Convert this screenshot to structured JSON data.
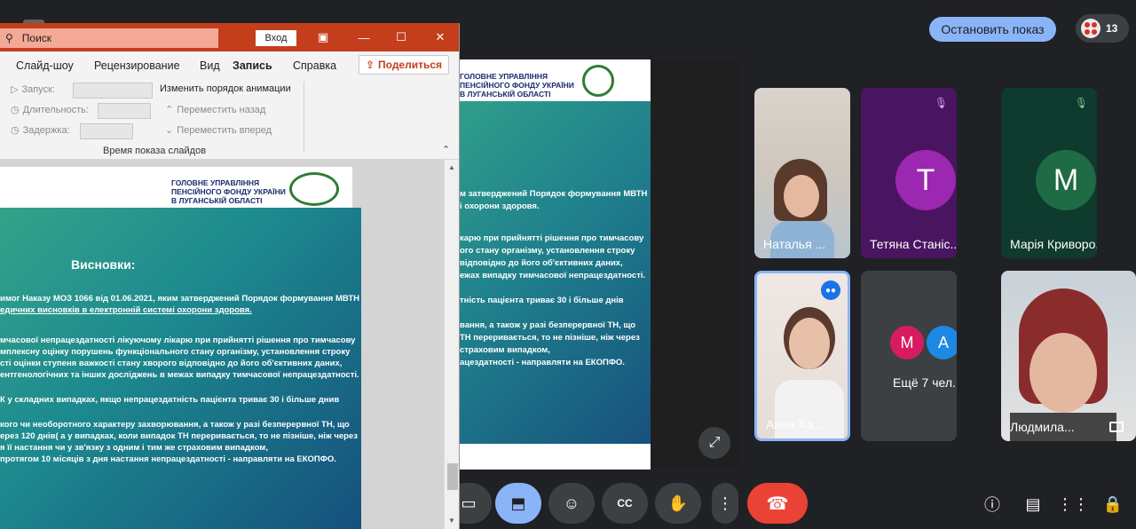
{
  "meet": {
    "stop_presenting": "Остановить показ",
    "participants_count": "13",
    "more_people": "Ещё 7 чел."
  },
  "ppt": {
    "search_placeholder": "Поиск",
    "login": "Вход",
    "tabs": [
      "Слайд-шоу",
      "Рецензирование",
      "Вид",
      "Запись",
      "Справка"
    ],
    "share": "Поделиться",
    "ribbon": {
      "start": "Запуск:",
      "duration": "Длительность:",
      "delay": "Задержка:",
      "reorder": "Изменить порядок анимации",
      "move_back": "Переместить назад",
      "move_forward": "Переместить вперед",
      "group_label": "Время показа слайдов"
    }
  },
  "slide": {
    "org_line1": "ГОЛОВНЕ УПРАВЛІННЯ",
    "org_line2": "ПЕНСІЙНОГО ФОНДУ УКРАЇНИ",
    "org_line3": "В ЛУГАНСЬКІЙ ОБЛАСТІ",
    "title": "Висновки:",
    "lines": [
      "имог Наказу МОЗ 1066 від 01.06.2021, яким затверджений Порядок формування МВТН",
      "едичних висновків в  електронній системі охорони здоровя.",
      "мчасової непрацездатності лікуючому лікарю при прийнятті рішення про тимчасову",
      "мплексну оцінку порушень функціонального стану організму, установлення строку",
      "сті оцінки ступеня важкості стану хворого відповідно до його об'єктивних даних,",
      "ентгенологічних та інших досліджень в межах випадку тимчасової непрацездатності.",
      "К у складних випадках, якщо непрацездатність пацієнта триває 30 і більше днив",
      "кого чи необоротного характеру захворювання, а також у разі безперервної ТН, що",
      "ерез 120 днів( а у випадках, коли випадок ТН переривається, то не пізніше, ніж через",
      "я її настання чи у зв'язку з одним і тим же страховим випадком,",
      "протягом 10 місяців з дня настання непрацездатності - направляти на ЕКОПФО."
    ],
    "present_lines": [
      "м затверджений Порядок формування МВТН",
      "і охорони здоровя.",
      "карю при прийнятті рішення про тимчасову",
      "ого стану організму, установлення строку",
      "відповідно до його об'єктивних даних,",
      "ежах випадку тимчасової непрацездатності.",
      "тність пацієнта триває 30 і більше днів",
      "вання, а також у разі безперервної ТН, що",
      " ТН переривається, то не пізніше, ніж через",
      " страховим випадком,",
      "ацездатності - направляти на ЕКОПФО."
    ]
  },
  "tiles": [
    {
      "name": "Наталья ...",
      "initial": ""
    },
    {
      "name": "Тетяна Станіс...",
      "initial": "Т",
      "color": "#9c27b0"
    },
    {
      "name": "Марія Криворо...",
      "initial": "М",
      "color": "#1e8e3e"
    },
    {
      "name": "Анна Ха...",
      "initial": ""
    },
    {
      "name": "Людмила...",
      "initial": ""
    }
  ],
  "more_avatars": [
    {
      "initial": "М",
      "color": "#d81b60"
    },
    {
      "initial": "А",
      "color": "#1e88e5"
    }
  ]
}
